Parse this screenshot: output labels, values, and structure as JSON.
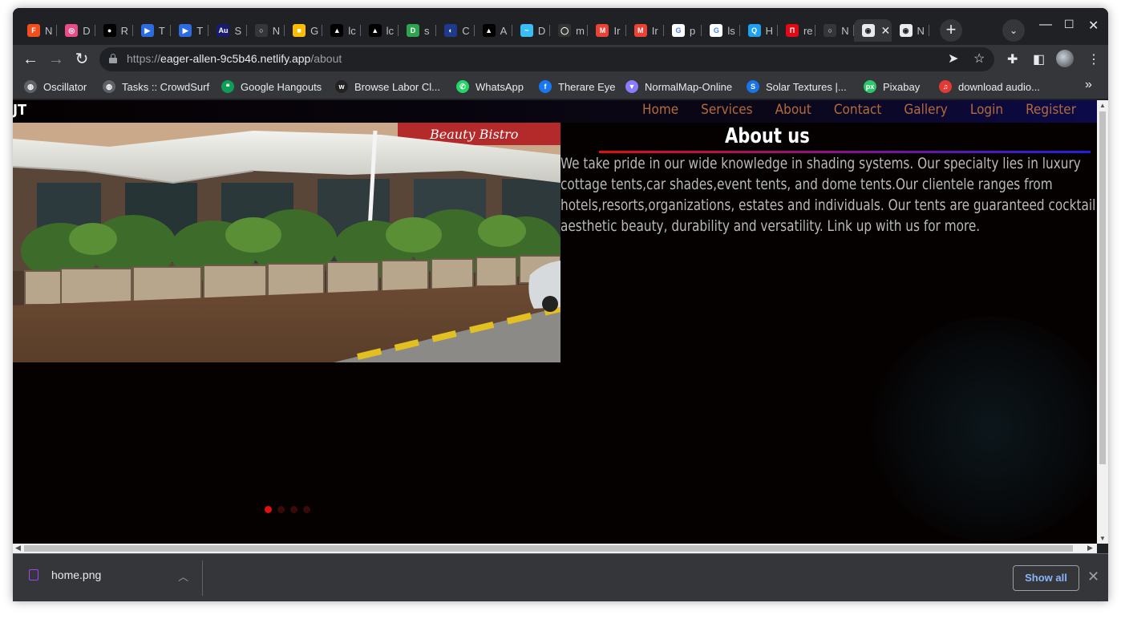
{
  "browser": {
    "tabs": [
      {
        "label": "N",
        "fav_color": "#f24e1e",
        "fav_text": "F"
      },
      {
        "label": "D",
        "fav_color": "#ea4c89",
        "fav_text": "◎"
      },
      {
        "label": "R",
        "fav_color": "#000000",
        "fav_text": "●"
      },
      {
        "label": "T",
        "fav_color": "#2d6cdf",
        "fav_text": "▶"
      },
      {
        "label": "T",
        "fav_color": "#2d6cdf",
        "fav_text": "▶"
      },
      {
        "label": "S",
        "fav_color": "#1a1a6e",
        "fav_text": "Au"
      },
      {
        "label": "N",
        "fav_color": "#35363a",
        "fav_text": "○"
      },
      {
        "label": "G",
        "fav_color": "#fbbc04",
        "fav_text": "■"
      },
      {
        "label": "lc",
        "fav_color": "#000000",
        "fav_text": "▲"
      },
      {
        "label": "lc",
        "fav_color": "#000000",
        "fav_text": "▲"
      },
      {
        "label": "s",
        "fav_color": "#2ea44f",
        "fav_text": "D"
      },
      {
        "label": "C",
        "fav_color": "#1e3a8a",
        "fav_text": "◐"
      },
      {
        "label": "A",
        "fav_color": "#000000",
        "fav_text": "▲"
      },
      {
        "label": "D",
        "fav_color": "#38bdf8",
        "fav_text": "~"
      },
      {
        "label": "m",
        "fav_color": "#333333",
        "fav_text": "◯"
      },
      {
        "label": "Ir",
        "fav_color": "#ea4335",
        "fav_text": "M"
      },
      {
        "label": "Ir",
        "fav_color": "#ea4335",
        "fav_text": "M"
      },
      {
        "label": "p",
        "fav_color": "#ffffff",
        "fav_text": "G"
      },
      {
        "label": "ls",
        "fav_color": "#ffffff",
        "fav_text": "G"
      },
      {
        "label": "H",
        "fav_color": "#1da1f2",
        "fav_text": "Q"
      },
      {
        "label": "re",
        "fav_color": "#e50914",
        "fav_text": "П"
      },
      {
        "label": "N",
        "fav_color": "#35363a",
        "fav_text": "○"
      },
      {
        "label": "",
        "fav_color": "#e8eaed",
        "fav_text": "◉",
        "active": true
      },
      {
        "label": "N",
        "fav_color": "#e8eaed",
        "fav_text": "◉"
      }
    ],
    "url_scheme": "https://",
    "url_host": "eager-allen-9c5b46.netlify.app",
    "url_path": "/about",
    "bookmarks": [
      {
        "label": "Oscillator",
        "fav_color": "#5f6368",
        "fav_text": "◍"
      },
      {
        "label": "Tasks :: CrowdSurf",
        "fav_color": "#5f6368",
        "fav_text": "◍"
      },
      {
        "label": "Google Hangouts",
        "fav_color": "#0f9d58",
        "fav_text": "❝"
      },
      {
        "label": "Browse Labor Cl...",
        "fav_color": "#222222",
        "fav_text": "w"
      },
      {
        "label": "WhatsApp",
        "fav_color": "#25d366",
        "fav_text": "✆"
      },
      {
        "label": "Therare Eye",
        "fav_color": "#1877f2",
        "fav_text": "f"
      },
      {
        "label": "NormalMap-Online",
        "fav_color": "#8a7cff",
        "fav_text": "▼"
      },
      {
        "label": "Solar Textures |...",
        "fav_color": "#1a73e8",
        "fav_text": "S"
      },
      {
        "label": "Pixabay",
        "fav_color": "#2ec66d",
        "fav_text": "px"
      },
      {
        "label": "download audio...",
        "fav_color": "#e53935",
        "fav_text": "♫"
      }
    ]
  },
  "site": {
    "logo": "JT",
    "nav": [
      "Home",
      "Services",
      "About",
      "Contact",
      "Gallery",
      "Login",
      "Register"
    ],
    "about_title": "About us",
    "about_text": "We take pride in our wide knowledge in shading systems. Our specialty lies in luxury cottage tents,car shades,event tents, and dome tents.Our clientele ranges from hotels,resorts,organizations, estates and individuals. Our tents are guaranteed cocktail aesthetic beauty, durability and versatility. Link up with us for more.",
    "hero_sign_text": "Beauty Bistro",
    "slider_active_index": 0,
    "slider_count": 4
  },
  "downloads": {
    "file_name": "home.png",
    "show_all_label": "Show all"
  },
  "colors": {
    "nav_link": "#b36a3c",
    "active_dot": "#e01010",
    "page_bg": "#050101"
  }
}
